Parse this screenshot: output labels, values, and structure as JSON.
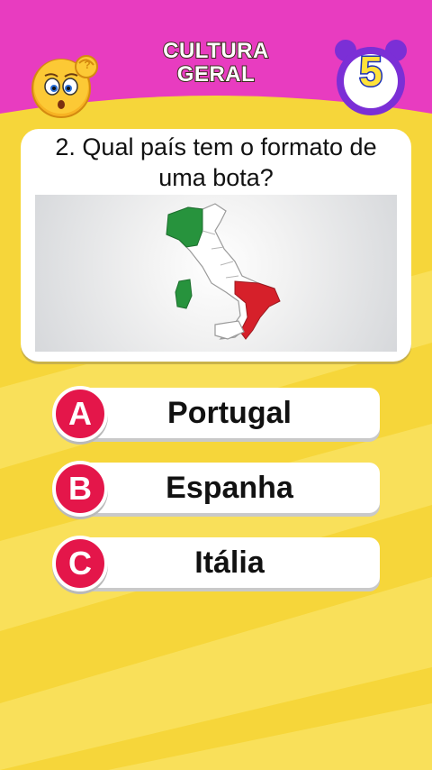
{
  "header": {
    "title_line1": "CULTURA",
    "title_line2": "GERAL",
    "timer_value": "5",
    "emoji_icon": "confused-face-icon",
    "timer_icon": "alarm-clock-icon",
    "colors": {
      "header_bg": "#e83cc0",
      "timer_ring": "#7b2fd6",
      "timer_digit": "#ffe23a"
    }
  },
  "question": {
    "text": "2. Qual país tem o formato de uma bota?",
    "image_icon": "italy-map-icon"
  },
  "answers": [
    {
      "letter": "A",
      "label": "Portugal"
    },
    {
      "letter": "B",
      "label": "Espanha"
    },
    {
      "letter": "C",
      "label": "Itália"
    }
  ],
  "colors": {
    "background": "#f7d93a",
    "badge": "#e4164a"
  }
}
